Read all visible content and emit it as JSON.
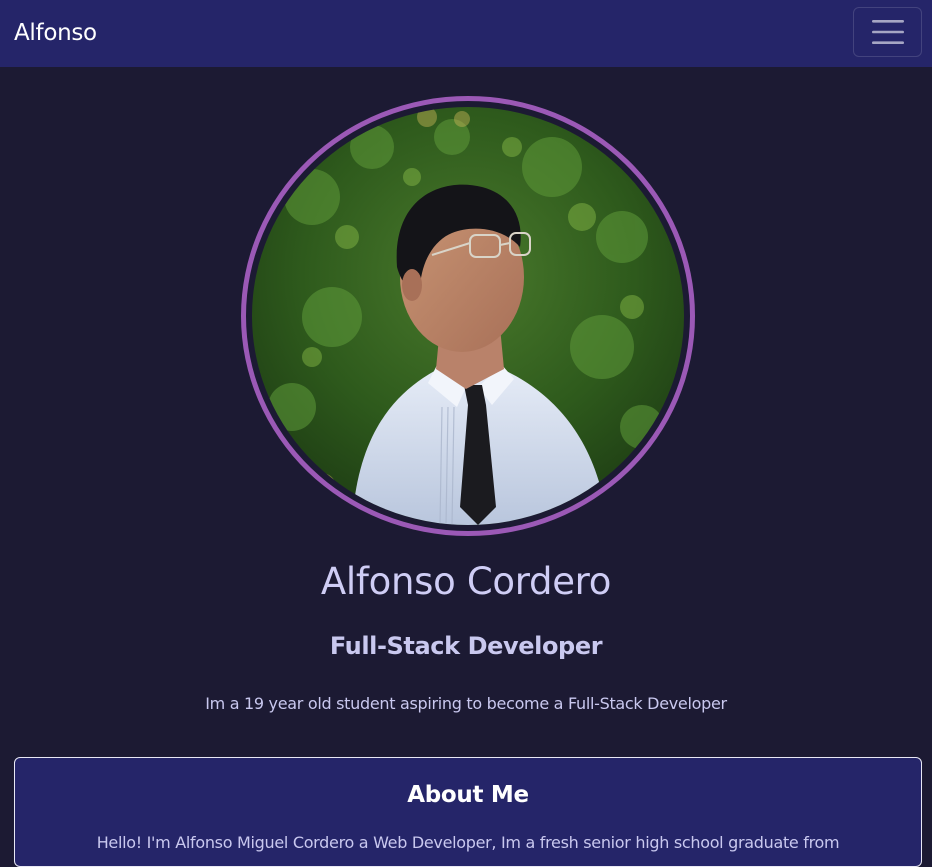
{
  "navbar": {
    "brand": "Alfonso",
    "menu_icon": "hamburger-menu-icon"
  },
  "hero": {
    "portrait_alt": "Alfonso Cordero portrait",
    "name": "Alfonso Cordero",
    "role": "Full-Stack Developer",
    "tagline": "Im a 19 year old student aspiring to become a Full-Stack Developer"
  },
  "about": {
    "title": "About Me",
    "text": "Hello! I'm Alfonso Miguel Cordero a Web Developer, Im a fresh senior high school graduate from"
  },
  "colors": {
    "navbar_bg": "#252569",
    "page_bg": "#1c1a33",
    "accent_ring": "#9b59b6",
    "text": "#c9c8ef"
  }
}
